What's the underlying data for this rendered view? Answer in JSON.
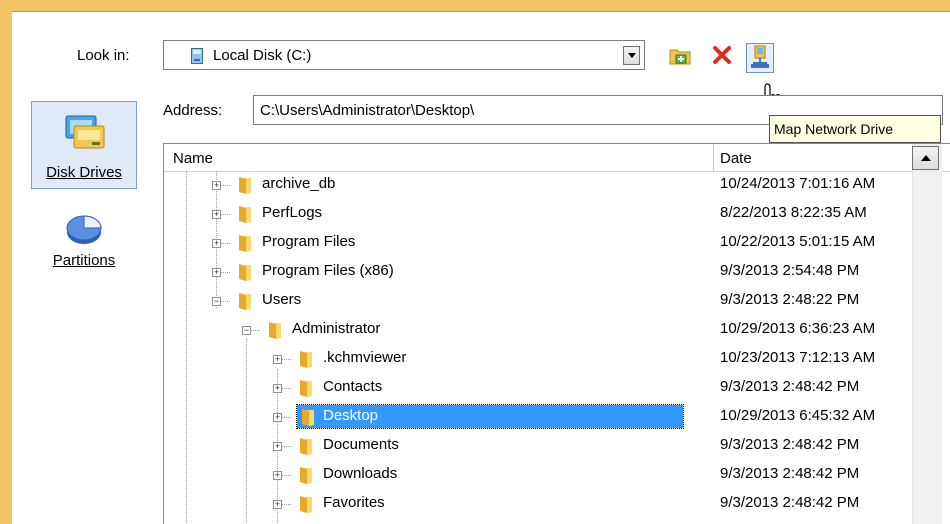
{
  "dialog": {
    "look_in_label": "Look in:",
    "look_in_value": "Local Disk (C:)",
    "address_label": "Address:",
    "address_value": "C:\\Users\\Administrator\\Desktop\\",
    "tooltip": "Map Network Drive"
  },
  "toolbar": {
    "buttons": [
      {
        "name": "new-folder",
        "icon": "new-folder-icon"
      },
      {
        "name": "delete",
        "icon": "delete-x-icon"
      },
      {
        "name": "map-network-drive",
        "icon": "network-drive-icon"
      }
    ]
  },
  "sidebar": {
    "items": [
      {
        "label": "Disk Drives",
        "icon": "disk-drives-icon",
        "selected": true
      },
      {
        "label": "Partitions",
        "icon": "partitions-pie-icon",
        "selected": false
      }
    ]
  },
  "tree": {
    "columns": [
      "Name",
      "Date"
    ],
    "rows": [
      {
        "name": "archive_db",
        "date": "10/24/2013 7:01:16 AM",
        "level": 0,
        "expanded": false
      },
      {
        "name": "PerfLogs",
        "date": "8/22/2013 8:22:35 AM",
        "level": 0,
        "expanded": false
      },
      {
        "name": "Program Files",
        "date": "10/22/2013 5:01:15 AM",
        "level": 0,
        "expanded": false
      },
      {
        "name": "Program Files (x86)",
        "date": "9/3/2013 2:54:48 PM",
        "level": 0,
        "expanded": false
      },
      {
        "name": "Users",
        "date": "9/3/2013 2:48:22 PM",
        "level": 0,
        "expanded": true
      },
      {
        "name": "Administrator",
        "date": "10/29/2013 6:36:23 AM",
        "level": 1,
        "expanded": true
      },
      {
        "name": ".kchmviewer",
        "date": "10/23/2013 7:12:13 AM",
        "level": 2,
        "expanded": false
      },
      {
        "name": "Contacts",
        "date": "9/3/2013 2:48:42 PM",
        "level": 2,
        "expanded": false
      },
      {
        "name": "Desktop",
        "date": "10/29/2013 6:45:32 AM",
        "level": 2,
        "expanded": false,
        "selected": true
      },
      {
        "name": "Documents",
        "date": "9/3/2013 2:48:42 PM",
        "level": 2,
        "expanded": false
      },
      {
        "name": "Downloads",
        "date": "9/3/2013 2:48:42 PM",
        "level": 2,
        "expanded": false
      },
      {
        "name": "Favorites",
        "date": "9/3/2013 2:48:42 PM",
        "level": 2,
        "expanded": false
      }
    ]
  },
  "colors": {
    "frame": "#f0c363",
    "selection": "#3399ff",
    "tooltip_bg": "#ffffe1"
  }
}
